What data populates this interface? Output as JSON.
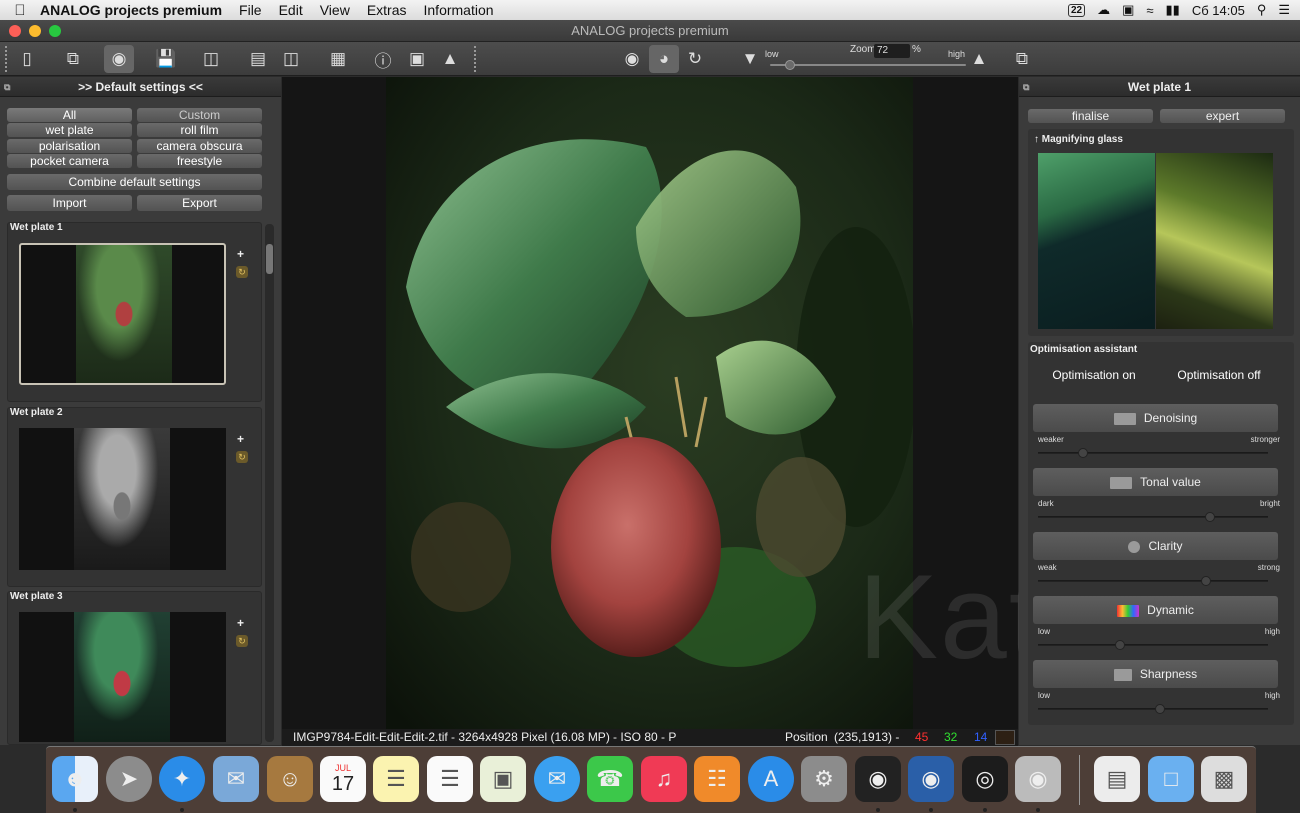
{
  "menubar": {
    "app_name": "ANALOG projects premium",
    "items": [
      "File",
      "Edit",
      "View",
      "Extras",
      "Information"
    ],
    "status_badge": "22",
    "clock": "Сб 14:05"
  },
  "window": {
    "title": "ANALOG projects premium"
  },
  "toolbar": {
    "zoom_label": "Zoom",
    "zoom_value": "72",
    "zoom_unit": "%",
    "low_label": "low",
    "high_label": "high",
    "zoom_slider_fraction": 0.08
  },
  "left_panel": {
    "header": ">> Default settings <<",
    "filters": [
      "All",
      "Custom",
      "wet plate",
      "roll film",
      "polarisation",
      "camera obscura",
      "pocket camera",
      "freestyle"
    ],
    "combine_label": "Combine default settings",
    "import_label": "Import",
    "export_label": "Export",
    "presets": [
      {
        "title": "Wet plate 1"
      },
      {
        "title": "Wet plate 2"
      },
      {
        "title": "Wet plate 3"
      }
    ]
  },
  "status": {
    "file_info": "IMGP9784-Edit-Edit-Edit-2.tif - 3264x4928 Pixel (16.08 MP)",
    "iso": "- ISO 80 - P",
    "position_label": "Position",
    "position_value": "(235,1913) -",
    "r": "45",
    "g": "32",
    "b": "14"
  },
  "right_panel": {
    "header": "Wet plate 1",
    "tab_finalise": "finalise",
    "tab_expert": "expert",
    "magnifier_label": "Magnifying glass",
    "opt_label": "Optimisation assistant",
    "opt_on": "Optimisation on",
    "opt_off": "Optimisation off",
    "params": [
      {
        "name": "Denoising",
        "left": "weaker",
        "right": "stronger",
        "value": 0.18
      },
      {
        "name": "Tonal value",
        "left": "dark",
        "right": "bright",
        "value": 0.76
      },
      {
        "name": "Clarity",
        "left": "weak",
        "right": "strong",
        "value": 0.74
      },
      {
        "name": "Dynamic",
        "left": "low",
        "right": "high",
        "value": 0.35
      },
      {
        "name": "Sharpness",
        "left": "low",
        "right": "high",
        "value": 0.53
      }
    ]
  },
  "watermark": "Kat©",
  "dock": {
    "calendar_month": "JUL",
    "calendar_day": "17"
  },
  "colors": {
    "accent_red": "#ff3030",
    "accent_green": "#30e030",
    "accent_blue": "#3060ff",
    "panel": "#3b3b3b"
  }
}
